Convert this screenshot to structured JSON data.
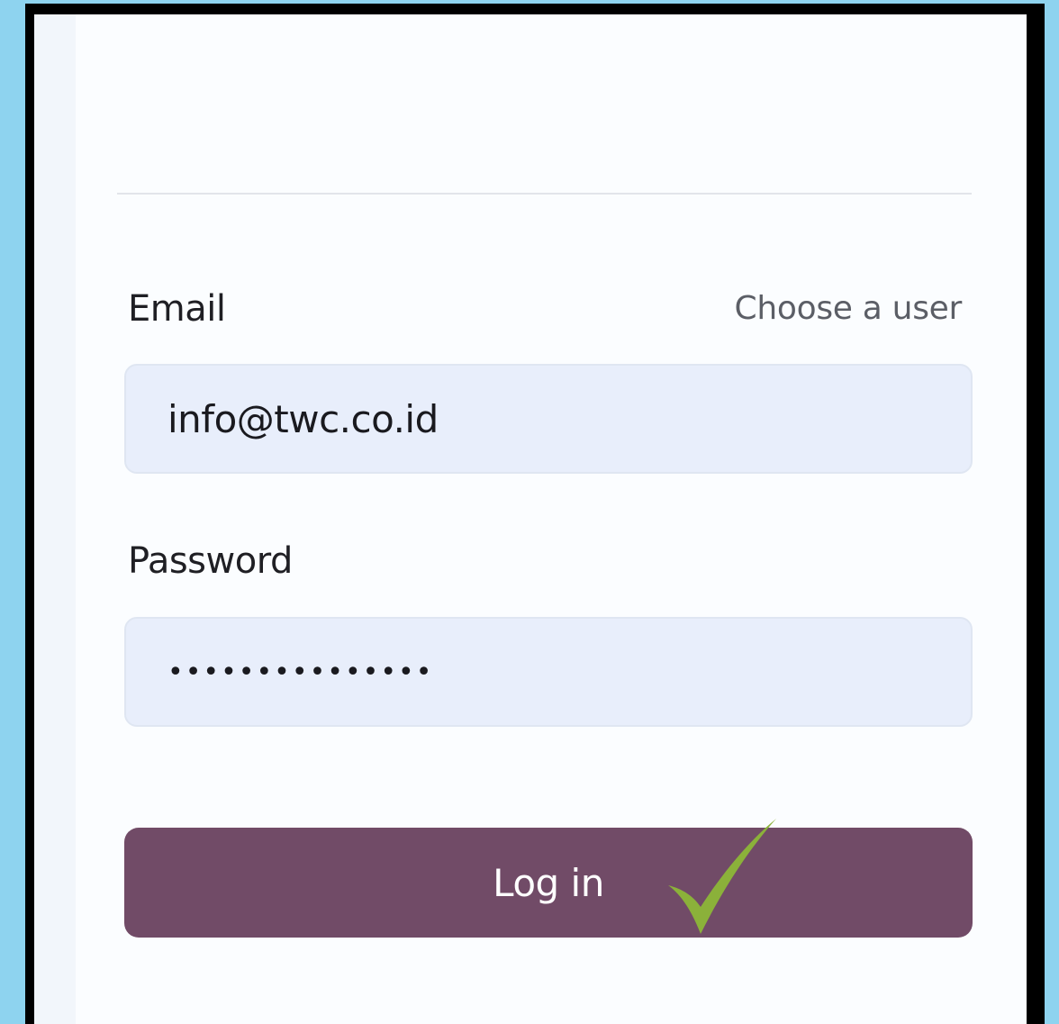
{
  "login_form": {
    "email_label": "Email",
    "choose_user_link": "Choose a user",
    "email_value": "info@twc.co.id",
    "password_label": "Password",
    "password_value": "•••••••••••••••",
    "login_button": "Log in"
  },
  "icons": {
    "check": "check-mark-icon"
  },
  "colors": {
    "page_background": "#8ed3ef",
    "frame": "#000000",
    "card_background": "#fbfdff",
    "field_background": "#e8eefb",
    "button_background": "#714b67",
    "button_text": "#ffffff",
    "check_mark": "#8bb13a"
  }
}
